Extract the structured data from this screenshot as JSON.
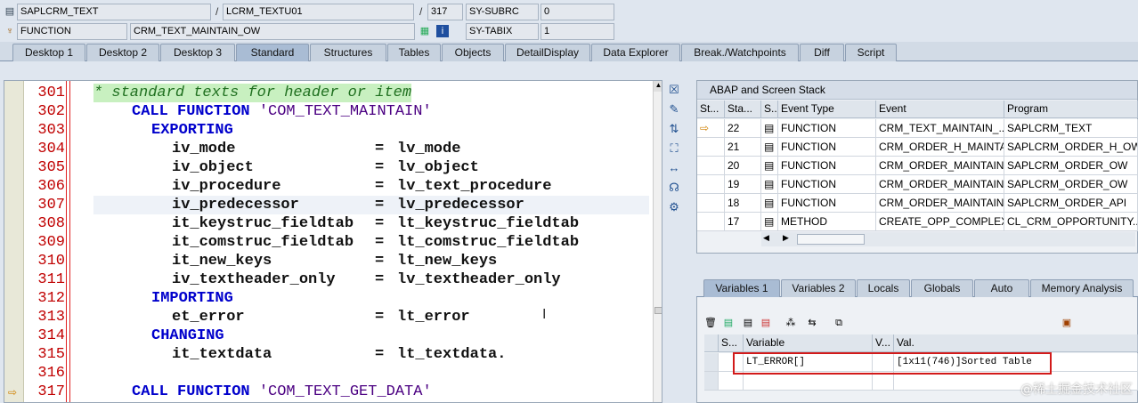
{
  "header": {
    "row1": {
      "program": "SAPLCRM_TEXT",
      "include": "LCRM_TEXTU01",
      "line": "317",
      "sysfield": "SY-SUBRC",
      "sysvalue": "0"
    },
    "row2": {
      "type": "FUNCTION",
      "name": "CRM_TEXT_MAINTAIN_OW",
      "sysfield": "SY-TABIX",
      "sysvalue": "1"
    },
    "separators": {
      "a": "/",
      "b": "/"
    }
  },
  "tabs": [
    "Desktop 1",
    "Desktop 2",
    "Desktop 3",
    "Standard",
    "Structures",
    "Tables",
    "Objects",
    "DetailDisplay",
    "Data Explorer",
    "Break./Watchpoints",
    "Diff",
    "Script"
  ],
  "active_tab": "Standard",
  "editor": {
    "lines": [
      {
        "num": "301",
        "text": "* standard texts for header or item"
      },
      {
        "num": "302",
        "kw": "CALL FUNCTION",
        "str": "'COM_TEXT_MAINTAIN'"
      },
      {
        "num": "303",
        "kw": "EXPORTING"
      },
      {
        "num": "304",
        "param": "iv_mode",
        "value": "lv_mode"
      },
      {
        "num": "305",
        "param": "iv_object",
        "value": "lv_object"
      },
      {
        "num": "306",
        "param": "iv_procedure",
        "value": "lv_text_procedure"
      },
      {
        "num": "307",
        "param": "iv_predecessor",
        "value": "lv_predecessor"
      },
      {
        "num": "308",
        "param": "it_keystruc_fieldtab",
        "value": "lt_keystruc_fieldtab"
      },
      {
        "num": "309",
        "param": "it_comstruc_fieldtab",
        "value": "lt_comstruc_fieldtab"
      },
      {
        "num": "310",
        "param": "it_new_keys",
        "value": "lt_new_keys"
      },
      {
        "num": "311",
        "param": "iv_textheader_only",
        "value": "lv_textheader_only"
      },
      {
        "num": "312",
        "kw": "IMPORTING"
      },
      {
        "num": "313",
        "param": "et_error",
        "value": "lt_error"
      },
      {
        "num": "314",
        "kw": "CHANGING"
      },
      {
        "num": "315",
        "param": "it_textdata",
        "value": "lt_textdata."
      },
      {
        "num": "316"
      },
      {
        "num": "317",
        "kw": "CALL FUNCTION",
        "str": "'COM_TEXT_GET_DATA'"
      }
    ],
    "eq": "="
  },
  "stack": {
    "title": "ABAP and Screen Stack",
    "columns": [
      "St...",
      "Sta...",
      "S...",
      "Event Type",
      "Event",
      "Program"
    ],
    "rows": [
      {
        "level": "22",
        "type": "FUNCTION",
        "event": "CRM_TEXT_MAINTAIN_...",
        "program": "SAPLCRM_TEXT",
        "current": true
      },
      {
        "level": "21",
        "type": "FUNCTION",
        "event": "CRM_ORDER_H_MAINTA...",
        "program": "SAPLCRM_ORDER_H_OW"
      },
      {
        "level": "20",
        "type": "FUNCTION",
        "event": "CRM_ORDER_MAINTAIN...",
        "program": "SAPLCRM_ORDER_OW"
      },
      {
        "level": "19",
        "type": "FUNCTION",
        "event": "CRM_ORDER_MAINTAIN...",
        "program": "SAPLCRM_ORDER_OW"
      },
      {
        "level": "18",
        "type": "FUNCTION",
        "event": "CRM_ORDER_MAINTAIN",
        "program": "SAPLCRM_ORDER_API"
      },
      {
        "level": "17",
        "type": "METHOD",
        "event": "CREATE_OPP_COMPLEX...",
        "program": "CL_CRM_OPPORTUNITY..."
      }
    ]
  },
  "var_tabs": [
    "Variables 1",
    "Variables 2",
    "Locals",
    "Globals",
    "Auto",
    "Memory Analysis"
  ],
  "var_active": "Variables 1",
  "vars": {
    "columns": [
      "S...",
      "Variable",
      "V...",
      "Val."
    ],
    "rows": [
      {
        "variable": "LT_ERROR[]",
        "value": "[1x11(746)]Sorted Table"
      }
    ]
  },
  "watermark": "@稀土掘金技术社区",
  "colors": {
    "accent": "#d21a1a",
    "keyword": "#0000cc",
    "linenum": "#c00000",
    "comment_bg": "#c8f0c0"
  }
}
